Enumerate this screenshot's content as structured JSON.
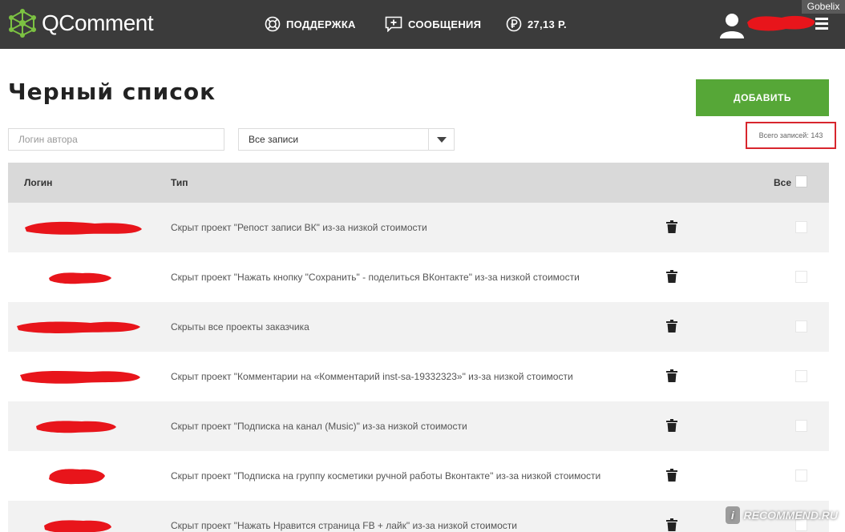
{
  "header": {
    "logo_text": "QComment",
    "nav": {
      "support_label": "ПОДДЕРЖКА",
      "messages_label": "СООБЩЕНИЯ",
      "balance_label": "27,13 Р."
    },
    "watermark_user": "Gobelix"
  },
  "page": {
    "title": "Черный список",
    "add_button_label": "ДОБАВИТЬ",
    "login_placeholder": "Логин автора",
    "type_filter_value": "Все записи",
    "total_records": "Всего записей: 143"
  },
  "table": {
    "columns": {
      "login": "Логин",
      "type": "Тип",
      "all": "Все"
    },
    "rows": [
      {
        "type": "Скрыт проект \"Репост записи ВК\" из-за низкой стоимости"
      },
      {
        "type": "Скрыт проект \"Нажать кнопку \"Сохранить\" - поделиться ВКонтакте\" из-за низкой стоимости"
      },
      {
        "type": "Скрыты все проекты заказчика"
      },
      {
        "type": "Скрыт проект \"Комментарии на «Комментарий inst-sa-19332323»\" из-за низкой стоимости"
      },
      {
        "type": "Скрыт проект \"Подписка на канал (Music)\" из-за низкой стоимости"
      },
      {
        "type": "Скрыт проект \"Подписка на группу косметики ручной работы Вконтакте\" из-за низкой стоимости"
      },
      {
        "type": "Скрыт проект \"Нажать Нравится страница FB + лайк\" из-за низкой стоимости"
      }
    ]
  },
  "watermark": "RECOMMEND.RU",
  "colors": {
    "topbar": "#3b3b3b",
    "accent_green": "#56a737",
    "logo_green": "#7cc242",
    "highlight_red": "#d8262d",
    "redaction_red": "#e8151b"
  }
}
